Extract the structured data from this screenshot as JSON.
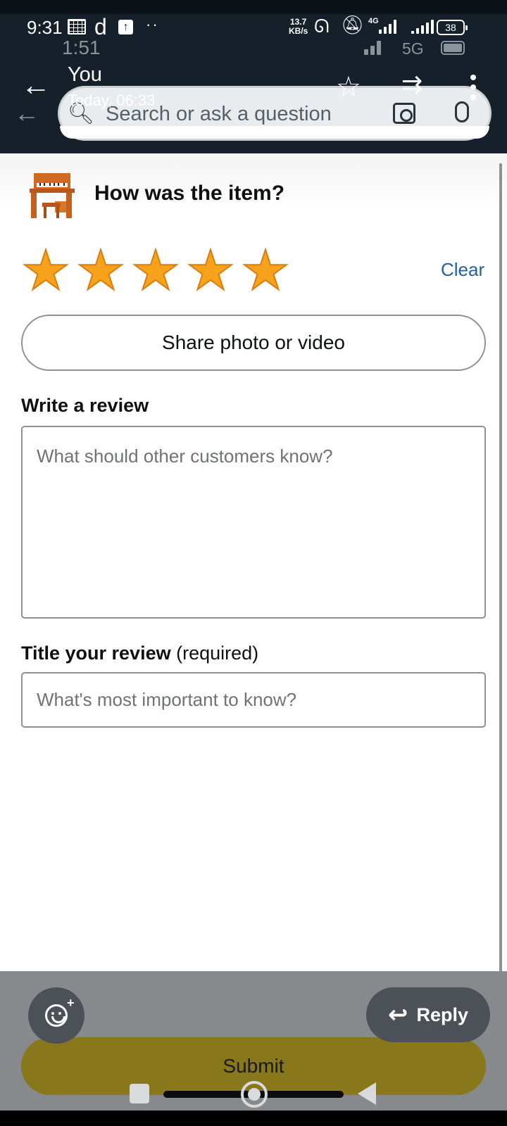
{
  "status_bar": {
    "time": "9:31",
    "carrier_glyph": "d",
    "upload_glyph": "↑",
    "dots": "··",
    "net_speed_value": "13.7",
    "net_speed_unit": "KB/s",
    "network_type": "4G",
    "battery": "38",
    "overlay_time": "1:51",
    "overlay_network": "5G"
  },
  "message_header": {
    "sender": "You",
    "sent_time": "Today, 06:33",
    "back_icon": "←",
    "star_icon": "☆",
    "forward_icon": "⇉"
  },
  "search": {
    "placeholder": "Search or ask a question"
  },
  "review": {
    "question": "How was the item?",
    "rating": 5,
    "max_rating": 5,
    "star_glyph": "★",
    "clear_label": "Clear",
    "share_button_label": "Share photo or video",
    "write_label": "Write a review",
    "write_placeholder": "What should other customers know?",
    "title_label_bold": "Title your review",
    "title_label_suffix": "(required)",
    "title_placeholder": "What's most important to know?",
    "submit_label": "Submit"
  },
  "overlay": {
    "reply_label": "Reply",
    "reply_icon": "↩",
    "emoji_plus": "+"
  },
  "colors": {
    "star": "#f7a21b",
    "link": "#2162a1",
    "submit": "#88771b",
    "header_bg": "#15202a"
  }
}
